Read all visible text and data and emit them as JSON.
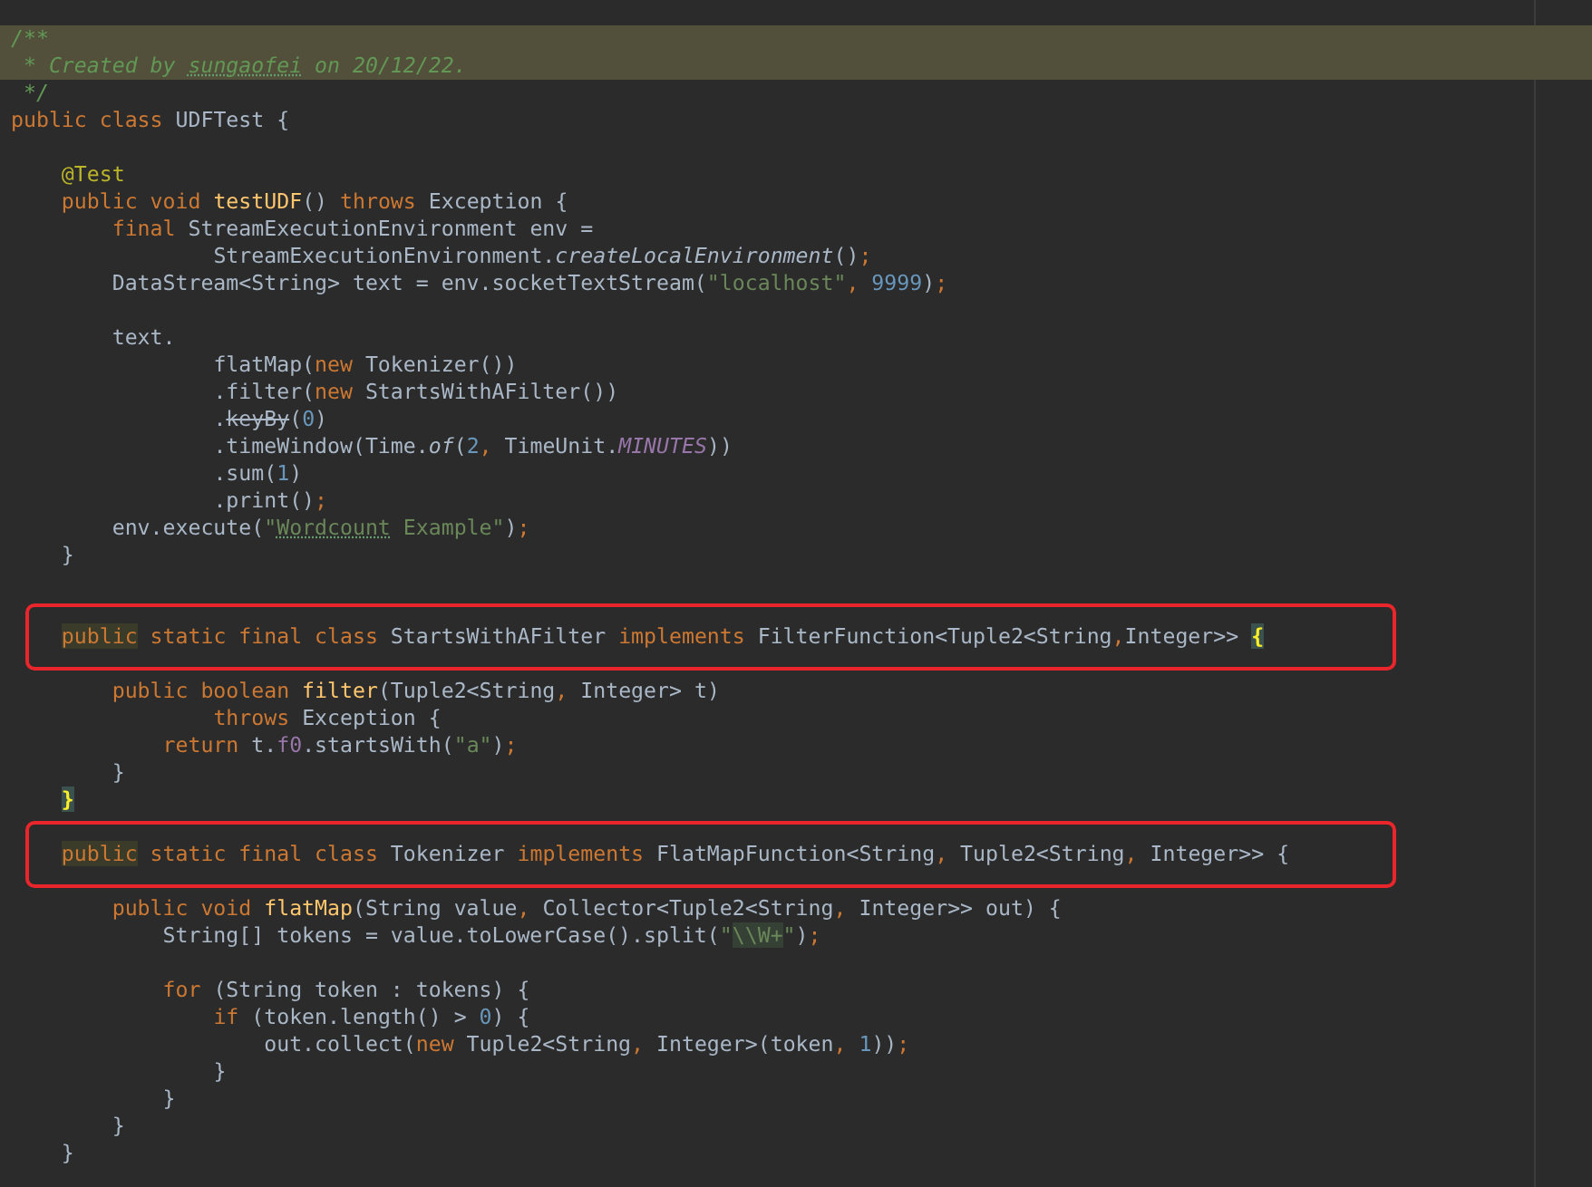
{
  "editor": {
    "lines": [
      {
        "kind": "code",
        "highlighted": true,
        "boxed": false,
        "tokens": [
          {
            "text": "/**",
            "kind": "comment"
          }
        ]
      },
      {
        "kind": "code",
        "highlighted": true,
        "boxed": false,
        "tokens": [
          {
            "text": " * Created by ",
            "kind": "comment"
          },
          {
            "text": "sungaofei",
            "kind": "comment_typo"
          },
          {
            "text": " on 20/12/22.",
            "kind": "comment"
          }
        ]
      },
      {
        "kind": "code",
        "highlighted": false,
        "boxed": false,
        "tokens": [
          {
            "text": " */",
            "kind": "comment"
          }
        ]
      },
      {
        "kind": "code",
        "highlighted": false,
        "boxed": false,
        "tokens": [
          {
            "text": "public class ",
            "kind": "keyword"
          },
          {
            "text": "UDFTest {",
            "kind": "plain"
          }
        ]
      },
      {
        "kind": "blank",
        "highlighted": false,
        "boxed": false
      },
      {
        "kind": "code",
        "highlighted": false,
        "boxed": false,
        "tokens": [
          {
            "text": "    @Test",
            "kind": "annotation"
          }
        ]
      },
      {
        "kind": "code",
        "highlighted": false,
        "boxed": false,
        "tokens": [
          {
            "text": "    public void ",
            "kind": "keyword"
          },
          {
            "text": "testUDF",
            "kind": "method"
          },
          {
            "text": "() ",
            "kind": "plain"
          },
          {
            "text": "throws ",
            "kind": "keyword"
          },
          {
            "text": "Exception {",
            "kind": "plain"
          }
        ]
      },
      {
        "kind": "code",
        "highlighted": false,
        "boxed": false,
        "tokens": [
          {
            "text": "        final ",
            "kind": "keyword"
          },
          {
            "text": "StreamExecutionEnvironment env =",
            "kind": "plain"
          }
        ]
      },
      {
        "kind": "code",
        "highlighted": false,
        "boxed": false,
        "tokens": [
          {
            "text": "                StreamExecutionEnvironment.",
            "kind": "plain"
          },
          {
            "text": "createLocalEnvironment",
            "kind": "static"
          },
          {
            "text": "()",
            "kind": "plain"
          },
          {
            "text": ";",
            "kind": "keyword"
          }
        ]
      },
      {
        "kind": "code",
        "highlighted": false,
        "boxed": false,
        "tokens": [
          {
            "text": "        DataStream<String> text = env.socketTextStream(",
            "kind": "plain"
          },
          {
            "text": "\"localhost\"",
            "kind": "string"
          },
          {
            "text": ", ",
            "kind": "keyword"
          },
          {
            "text": "9999",
            "kind": "number"
          },
          {
            "text": ")",
            "kind": "plain"
          },
          {
            "text": ";",
            "kind": "keyword"
          }
        ]
      },
      {
        "kind": "blank",
        "highlighted": false,
        "boxed": false
      },
      {
        "kind": "code",
        "highlighted": false,
        "boxed": false,
        "tokens": [
          {
            "text": "        text.",
            "kind": "plain"
          }
        ]
      },
      {
        "kind": "code",
        "highlighted": false,
        "boxed": false,
        "tokens": [
          {
            "text": "                flatMap(",
            "kind": "plain"
          },
          {
            "text": "new ",
            "kind": "keyword"
          },
          {
            "text": "Tokenizer())",
            "kind": "plain"
          }
        ]
      },
      {
        "kind": "code",
        "highlighted": false,
        "boxed": false,
        "tokens": [
          {
            "text": "                .filter(",
            "kind": "plain"
          },
          {
            "text": "new ",
            "kind": "keyword"
          },
          {
            "text": "StartsWithAFilter())",
            "kind": "plain"
          }
        ]
      },
      {
        "kind": "code",
        "highlighted": false,
        "boxed": false,
        "tokens": [
          {
            "text": "                .",
            "kind": "plain"
          },
          {
            "text": "keyBy",
            "kind": "deprecated"
          },
          {
            "text": "(",
            "kind": "plain"
          },
          {
            "text": "0",
            "kind": "number"
          },
          {
            "text": ")",
            "kind": "plain"
          }
        ]
      },
      {
        "kind": "code",
        "highlighted": false,
        "boxed": false,
        "tokens": [
          {
            "text": "                .timeWindow(Time.",
            "kind": "plain"
          },
          {
            "text": "of",
            "kind": "static"
          },
          {
            "text": "(",
            "kind": "plain"
          },
          {
            "text": "2",
            "kind": "number"
          },
          {
            "text": ", ",
            "kind": "keyword"
          },
          {
            "text": "TimeUnit.",
            "kind": "plain"
          },
          {
            "text": "MINUTES",
            "kind": "constant"
          },
          {
            "text": "))",
            "kind": "plain"
          }
        ]
      },
      {
        "kind": "code",
        "highlighted": false,
        "boxed": false,
        "tokens": [
          {
            "text": "                .sum(",
            "kind": "plain"
          },
          {
            "text": "1",
            "kind": "number"
          },
          {
            "text": ")",
            "kind": "plain"
          }
        ]
      },
      {
        "kind": "code",
        "highlighted": false,
        "boxed": false,
        "tokens": [
          {
            "text": "                .print()",
            "kind": "plain"
          },
          {
            "text": ";",
            "kind": "keyword"
          }
        ]
      },
      {
        "kind": "code",
        "highlighted": false,
        "boxed": false,
        "tokens": [
          {
            "text": "        env.execute(",
            "kind": "plain"
          },
          {
            "text": "\"",
            "kind": "string"
          },
          {
            "text": "Wordcount",
            "kind": "string_typo"
          },
          {
            "text": " Example\"",
            "kind": "string"
          },
          {
            "text": ")",
            "kind": "plain"
          },
          {
            "text": ";",
            "kind": "keyword"
          }
        ]
      },
      {
        "kind": "code",
        "highlighted": false,
        "boxed": false,
        "tokens": [
          {
            "text": "    }",
            "kind": "plain"
          }
        ]
      },
      {
        "kind": "blank",
        "highlighted": false,
        "boxed": false
      },
      {
        "kind": "blank",
        "highlighted": false,
        "boxed": false
      },
      {
        "kind": "code",
        "highlighted": false,
        "boxed": true,
        "tokens": [
          {
            "text": "    public",
            "kind": "keyword_marked"
          },
          {
            "text": " static final class ",
            "kind": "keyword"
          },
          {
            "text": "StartsWithAFilter ",
            "kind": "plain"
          },
          {
            "text": "implements ",
            "kind": "keyword"
          },
          {
            "text": "FilterFunction<Tuple2<String",
            "kind": "plain"
          },
          {
            "text": ",",
            "kind": "keyword"
          },
          {
            "text": "Integer>> ",
            "kind": "plain"
          },
          {
            "text": "{",
            "kind": "brace_match"
          }
        ]
      },
      {
        "kind": "blank",
        "highlighted": false,
        "boxed": false
      },
      {
        "kind": "code",
        "highlighted": false,
        "boxed": false,
        "tokens": [
          {
            "text": "        public boolean ",
            "kind": "keyword"
          },
          {
            "text": "filter",
            "kind": "method"
          },
          {
            "text": "(Tuple2<String",
            "kind": "plain"
          },
          {
            "text": ", ",
            "kind": "keyword"
          },
          {
            "text": "Integer> t)",
            "kind": "plain"
          }
        ]
      },
      {
        "kind": "code",
        "highlighted": false,
        "boxed": false,
        "tokens": [
          {
            "text": "                throws ",
            "kind": "keyword"
          },
          {
            "text": "Exception {",
            "kind": "plain"
          }
        ]
      },
      {
        "kind": "code",
        "highlighted": false,
        "boxed": false,
        "tokens": [
          {
            "text": "            return ",
            "kind": "keyword"
          },
          {
            "text": "t.",
            "kind": "plain"
          },
          {
            "text": "f0",
            "kind": "field"
          },
          {
            "text": ".startsWith(",
            "kind": "plain"
          },
          {
            "text": "\"a\"",
            "kind": "string"
          },
          {
            "text": ")",
            "kind": "plain"
          },
          {
            "text": ";",
            "kind": "keyword"
          }
        ]
      },
      {
        "kind": "code",
        "highlighted": false,
        "boxed": false,
        "tokens": [
          {
            "text": "        }",
            "kind": "plain"
          }
        ]
      },
      {
        "kind": "code",
        "highlighted": false,
        "boxed": false,
        "tokens": [
          {
            "text": "    }",
            "kind": "brace_match"
          }
        ]
      },
      {
        "kind": "blank",
        "highlighted": false,
        "boxed": false
      },
      {
        "kind": "code",
        "highlighted": false,
        "boxed": true,
        "tokens": [
          {
            "text": "    public",
            "kind": "keyword_marked"
          },
          {
            "text": " static final class ",
            "kind": "keyword"
          },
          {
            "text": "Tokenizer ",
            "kind": "plain"
          },
          {
            "text": "implements ",
            "kind": "keyword"
          },
          {
            "text": "FlatMapFunction<String",
            "kind": "plain"
          },
          {
            "text": ", ",
            "kind": "keyword"
          },
          {
            "text": "Tuple2<String",
            "kind": "plain"
          },
          {
            "text": ", ",
            "kind": "keyword"
          },
          {
            "text": "Integer>> {",
            "kind": "plain"
          }
        ]
      },
      {
        "kind": "blank",
        "highlighted": false,
        "boxed": false
      },
      {
        "kind": "code",
        "highlighted": false,
        "boxed": false,
        "tokens": [
          {
            "text": "        public void ",
            "kind": "keyword"
          },
          {
            "text": "flatMap",
            "kind": "method"
          },
          {
            "text": "(String value",
            "kind": "plain"
          },
          {
            "text": ", ",
            "kind": "keyword"
          },
          {
            "text": "Collector<Tuple2<String",
            "kind": "plain"
          },
          {
            "text": ", ",
            "kind": "keyword"
          },
          {
            "text": "Integer>> out) {",
            "kind": "plain"
          }
        ]
      },
      {
        "kind": "code",
        "highlighted": false,
        "boxed": false,
        "tokens": [
          {
            "text": "            String[] tokens = value.toLowerCase().split(",
            "kind": "plain"
          },
          {
            "text": "\"",
            "kind": "string"
          },
          {
            "text": "\\\\W+",
            "kind": "regex"
          },
          {
            "text": "\"",
            "kind": "string"
          },
          {
            "text": ")",
            "kind": "plain"
          },
          {
            "text": ";",
            "kind": "keyword"
          }
        ]
      },
      {
        "kind": "blank",
        "highlighted": false,
        "boxed": false
      },
      {
        "kind": "code",
        "highlighted": false,
        "boxed": false,
        "tokens": [
          {
            "text": "            for ",
            "kind": "keyword"
          },
          {
            "text": "(String token : tokens) {",
            "kind": "plain"
          }
        ]
      },
      {
        "kind": "code",
        "highlighted": false,
        "boxed": false,
        "tokens": [
          {
            "text": "                if ",
            "kind": "keyword"
          },
          {
            "text": "(token.length() > ",
            "kind": "plain"
          },
          {
            "text": "0",
            "kind": "number"
          },
          {
            "text": ") {",
            "kind": "plain"
          }
        ]
      },
      {
        "kind": "code",
        "highlighted": false,
        "boxed": false,
        "tokens": [
          {
            "text": "                    out.collect(",
            "kind": "plain"
          },
          {
            "text": "new ",
            "kind": "keyword"
          },
          {
            "text": "Tuple2<String",
            "kind": "plain"
          },
          {
            "text": ", ",
            "kind": "keyword"
          },
          {
            "text": "Integer>(token",
            "kind": "plain"
          },
          {
            "text": ", ",
            "kind": "keyword"
          },
          {
            "text": "1",
            "kind": "number"
          },
          {
            "text": "))",
            "kind": "plain"
          },
          {
            "text": ";",
            "kind": "keyword"
          }
        ]
      },
      {
        "kind": "code",
        "highlighted": false,
        "boxed": false,
        "tokens": [
          {
            "text": "                }",
            "kind": "plain"
          }
        ]
      },
      {
        "kind": "code",
        "highlighted": false,
        "boxed": false,
        "tokens": [
          {
            "text": "            }",
            "kind": "plain"
          }
        ]
      },
      {
        "kind": "code",
        "highlighted": false,
        "boxed": false,
        "tokens": [
          {
            "text": "        }",
            "kind": "plain"
          }
        ]
      },
      {
        "kind": "code",
        "highlighted": false,
        "boxed": false,
        "tokens": [
          {
            "text": "    }",
            "kind": "plain"
          }
        ]
      }
    ]
  }
}
